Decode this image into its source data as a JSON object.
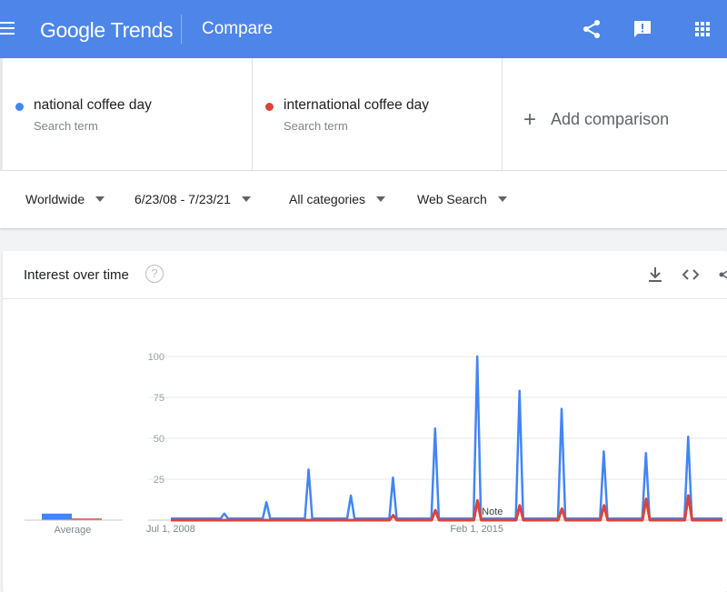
{
  "header": {
    "logo_google": "Google",
    "logo_trends": "Trends",
    "title": "Compare",
    "icons": [
      "menu-icon",
      "share-icon",
      "feedback-icon",
      "apps-icon"
    ]
  },
  "terms": [
    {
      "name": "national coffee day",
      "sub": "Search term",
      "color": "#4285f4"
    },
    {
      "name": "international coffee day",
      "sub": "Search term",
      "color": "#db4437"
    }
  ],
  "add_comparison": "Add comparison",
  "filters": {
    "region": "Worldwide",
    "date_range": "6/23/08 - 7/23/21",
    "category": "All categories",
    "search_type": "Web Search"
  },
  "card": {
    "title": "Interest over time",
    "help": "?",
    "icons": [
      "download-icon",
      "embed-icon",
      "share-icon"
    ]
  },
  "chart_data": {
    "type": "line",
    "y_ticks": [
      "100",
      "75",
      "50",
      "25"
    ],
    "ylim": [
      0,
      100
    ],
    "x_tick_labels": [
      "Jul 1, 2008",
      "Feb 1, 2015"
    ],
    "average_label": "Average",
    "note_label": "Note",
    "averages": [
      4,
      1
    ],
    "grid": true,
    "series": [
      {
        "name": "national coffee day",
        "color": "#4285f4",
        "peaks": [
          {
            "date": "2009-09-29",
            "value": 4
          },
          {
            "date": "2010-09-29",
            "value": 11
          },
          {
            "date": "2011-09-29",
            "value": 31
          },
          {
            "date": "2012-09-29",
            "value": 15
          },
          {
            "date": "2013-09-29",
            "value": 26
          },
          {
            "date": "2014-09-29",
            "value": 56
          },
          {
            "date": "2015-09-29",
            "value": 100
          },
          {
            "date": "2016-09-29",
            "value": 79
          },
          {
            "date": "2017-09-29",
            "value": 68
          },
          {
            "date": "2018-09-29",
            "value": 42
          },
          {
            "date": "2019-09-29",
            "value": 41
          },
          {
            "date": "2020-09-29",
            "value": 51
          }
        ],
        "baseline": 1
      },
      {
        "name": "international coffee day",
        "color": "#db4437",
        "peaks": [
          {
            "date": "2013-10-01",
            "value": 3
          },
          {
            "date": "2014-10-01",
            "value": 6
          },
          {
            "date": "2015-10-01",
            "value": 12
          },
          {
            "date": "2016-10-01",
            "value": 9
          },
          {
            "date": "2017-10-01",
            "value": 7
          },
          {
            "date": "2018-10-01",
            "value": 9
          },
          {
            "date": "2019-10-01",
            "value": 13
          },
          {
            "date": "2020-10-01",
            "value": 15
          }
        ],
        "baseline": 0
      }
    ]
  }
}
